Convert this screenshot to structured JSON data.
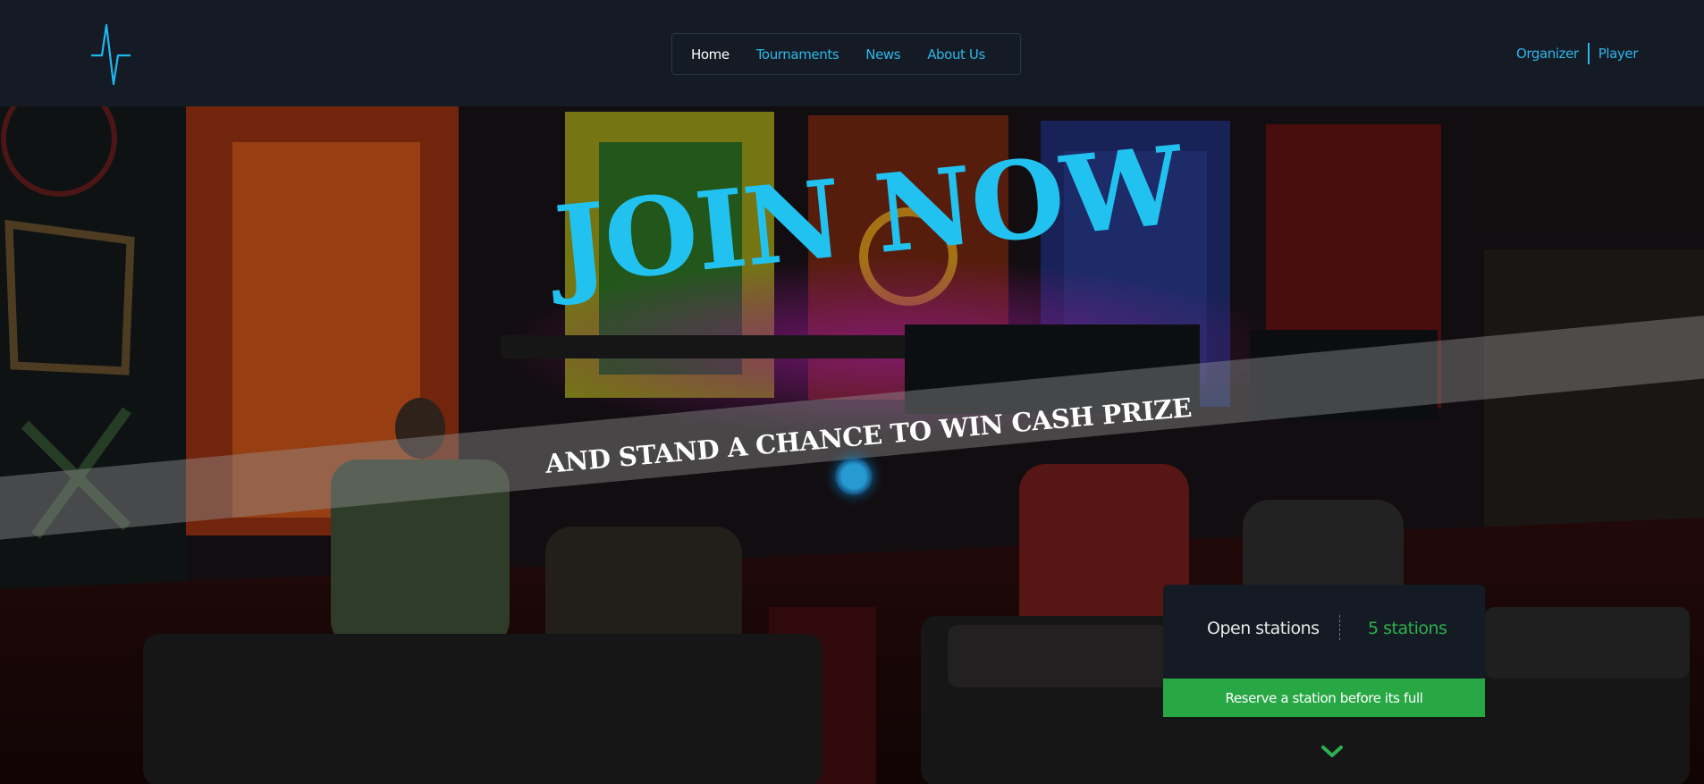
{
  "nav": {
    "links": [
      "Home",
      "Tournaments",
      "News",
      "About Us"
    ],
    "active": "Home"
  },
  "auth": {
    "organizer": "Organizer",
    "player": "Player"
  },
  "hero": {
    "headline": "JOIN NOW",
    "tagline": "AND STAND A CHANCE TO WIN CASH PRIZE"
  },
  "stations": {
    "label": "Open stations",
    "value": "5 stations",
    "cta": "Reserve a station before its full"
  },
  "icons": {
    "logo": "heartbeat-pulse-icon",
    "scroll": "chevron-down-icon"
  },
  "colors": {
    "accent": "#22c2f0",
    "success": "#27a845",
    "navbar": "#141b24"
  }
}
